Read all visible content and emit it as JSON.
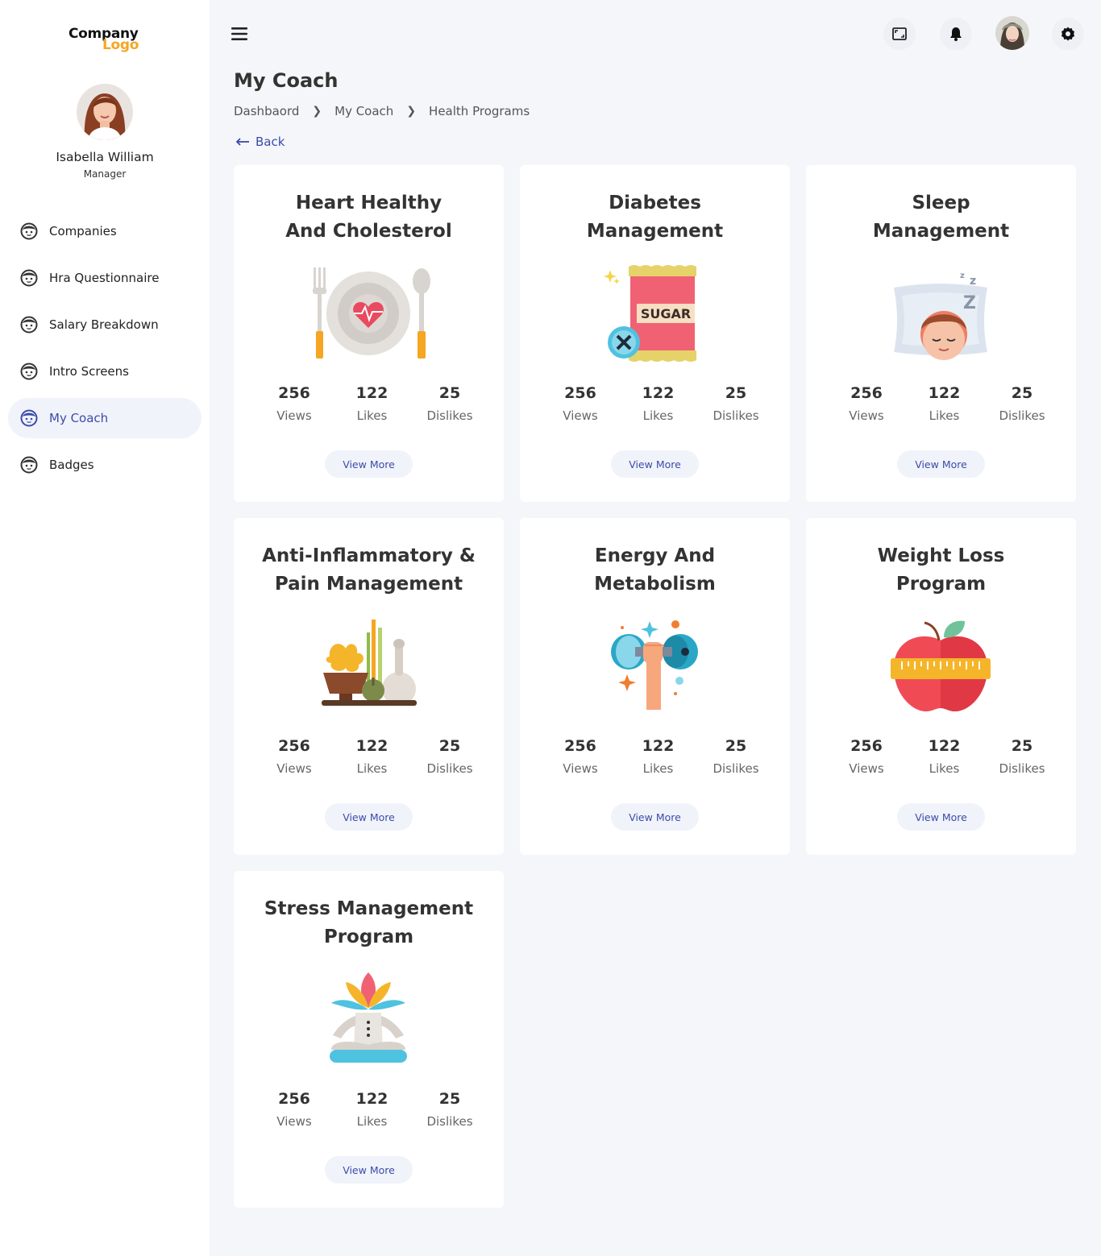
{
  "brand": {
    "logo_line1": "Company",
    "logo_line2": "Logo"
  },
  "user": {
    "name": "Isabella William",
    "role": "Manager"
  },
  "nav": [
    {
      "label": "Companies",
      "active": false
    },
    {
      "label": "Hra Questionnaire",
      "active": false
    },
    {
      "label": "Salary Breakdown",
      "active": false
    },
    {
      "label": "Intro Screens",
      "active": false
    },
    {
      "label": "My Coach",
      "active": true
    },
    {
      "label": "Badges",
      "active": false
    }
  ],
  "header": {
    "icons": [
      "fullscreen-icon",
      "bell-icon",
      "user-avatar",
      "gear-icon"
    ]
  },
  "page": {
    "title": "My Coach",
    "breadcrumb": [
      "Dashbaord",
      "My Coach",
      "Health Programs"
    ],
    "back_label": "Back"
  },
  "cards": [
    {
      "title_line1": "Heart Healthy",
      "title_line2": "And Cholesterol",
      "views": "256",
      "views_label": "Views",
      "likes": "122",
      "likes_label": "Likes",
      "dislikes": "25",
      "dislikes_label": "Dislikes",
      "button": "View More",
      "illustration": "heart-plate-icon"
    },
    {
      "title_line1": "Diabetes",
      "title_line2": "Management",
      "views": "256",
      "views_label": "Views",
      "likes": "122",
      "likes_label": "Likes",
      "dislikes": "25",
      "dislikes_label": "Dislikes",
      "button": "View More",
      "illustration": "sugar-icon"
    },
    {
      "title_line1": "Sleep",
      "title_line2": "Management",
      "views": "256",
      "views_label": "Views",
      "likes": "122",
      "likes_label": "Likes",
      "dislikes": "25",
      "dislikes_label": "Dislikes",
      "button": "View More",
      "illustration": "sleep-icon"
    },
    {
      "title_line1": "Anti-Inflammatory &",
      "title_line2": "Pain Management",
      "views": "256",
      "views_label": "Views",
      "likes": "122",
      "likes_label": "Likes",
      "dislikes": "25",
      "dislikes_label": "Dislikes",
      "button": "View More",
      "illustration": "herbs-icon"
    },
    {
      "title_line1": "Energy And",
      "title_line2": "Metabolism",
      "views": "256",
      "views_label": "Views",
      "likes": "122",
      "likes_label": "Likes",
      "dislikes": "25",
      "dislikes_label": "Dislikes",
      "button": "View More",
      "illustration": "dumbbell-icon"
    },
    {
      "title_line1": "Weight Loss",
      "title_line2": "Program",
      "views": "256",
      "views_label": "Views",
      "likes": "122",
      "likes_label": "Likes",
      "dislikes": "25",
      "dislikes_label": "Dislikes",
      "button": "View More",
      "illustration": "apple-tape-icon"
    },
    {
      "title_line1": "Stress Management",
      "title_line2": "Program",
      "views": "256",
      "views_label": "Views",
      "likes": "122",
      "likes_label": "Likes",
      "dislikes": "25",
      "dislikes_label": "Dislikes",
      "button": "View More",
      "illustration": "meditation-icon"
    }
  ],
  "colors": {
    "accent": "#3b4ca8",
    "logo_orange": "#f5a623",
    "background": "#f5f6fa",
    "active_nav_bg": "#f1f3fb"
  }
}
